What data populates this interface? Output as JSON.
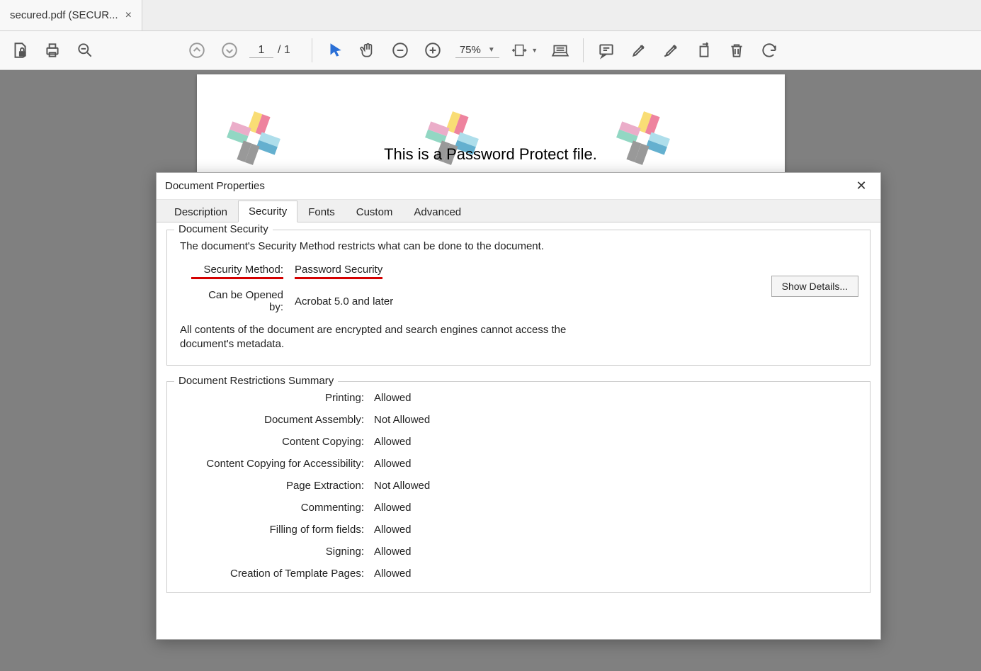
{
  "tab": {
    "title": "secured.pdf (SECUR...",
    "close": "×"
  },
  "toolbar": {
    "page_current": "1",
    "page_sep": "/",
    "page_total": "1",
    "zoom": "75%"
  },
  "document": {
    "page_text": "This is a Password Protect file."
  },
  "dialog": {
    "title": "Document Properties",
    "tabs": [
      "Description",
      "Security",
      "Fonts",
      "Custom",
      "Advanced"
    ],
    "active_tab": 1,
    "security": {
      "section_title": "Document Security",
      "desc": "The document's Security Method restricts what can be done to the document.",
      "method_label": "Security Method:",
      "method_value": "Password Security",
      "opened_label": "Can be Opened by:",
      "opened_value": "Acrobat 5.0 and later",
      "details_btn": "Show Details...",
      "note": "All contents of the document are encrypted and search engines cannot access the document's metadata."
    },
    "restrictions": {
      "section_title": "Document Restrictions Summary",
      "items": [
        {
          "label": "Printing:",
          "value": "Allowed"
        },
        {
          "label": "Document Assembly:",
          "value": "Not Allowed"
        },
        {
          "label": "Content Copying:",
          "value": "Allowed"
        },
        {
          "label": "Content Copying for Accessibility:",
          "value": "Allowed"
        },
        {
          "label": "Page Extraction:",
          "value": "Not Allowed"
        },
        {
          "label": "Commenting:",
          "value": "Allowed"
        },
        {
          "label": "Filling of form fields:",
          "value": "Allowed"
        },
        {
          "label": "Signing:",
          "value": "Allowed"
        },
        {
          "label": "Creation of Template Pages:",
          "value": "Allowed"
        }
      ]
    }
  }
}
